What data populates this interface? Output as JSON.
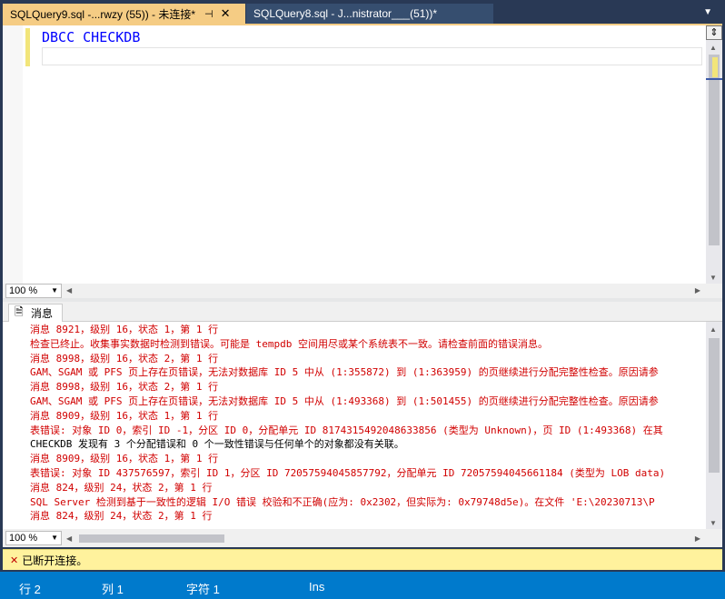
{
  "tabs": [
    {
      "label": "SQLQuery9.sql -...rwzy (55)) - 未连接*",
      "active": true
    },
    {
      "label": "SQLQuery8.sql - J...nistrator___(51))*",
      "active": false
    }
  ],
  "editor": {
    "code_line_1": "DBCC CHECKDB",
    "zoom": "100 %"
  },
  "results": {
    "tab_label": "消息",
    "messages": [
      {
        "text": "消息 8921，级别 16，状态 1，第 1 行",
        "kind": "err"
      },
      {
        "text": "检查已终止。收集事实数据时检测到错误。可能是 tempdb 空间用尽或某个系统表不一致。请检查前面的错误消息。",
        "kind": "err"
      },
      {
        "text": "消息 8998，级别 16，状态 2，第 1 行",
        "kind": "err"
      },
      {
        "text": "GAM、SGAM 或 PFS 页上存在页错误，无法对数据库 ID 5 中从 (1:355872) 到 (1:363959) 的页继续进行分配完整性检查。原因请参",
        "kind": "err"
      },
      {
        "text": "消息 8998，级别 16，状态 2，第 1 行",
        "kind": "err"
      },
      {
        "text": "GAM、SGAM 或 PFS 页上存在页错误，无法对数据库 ID 5 中从 (1:493368) 到 (1:501455) 的页继续进行分配完整性检查。原因请参",
        "kind": "err"
      },
      {
        "text": "消息 8909，级别 16，状态 1，第 1 行",
        "kind": "err"
      },
      {
        "text": "表错误: 对象 ID 0，索引 ID -1，分区 ID 0，分配单元 ID 8174315492048633856 (类型为 Unknown)，页 ID (1:493368) 在其",
        "kind": "err"
      },
      {
        "text": "CHECKDB 发现有 3 个分配错误和 0 个一致性错误与任何单个的对象都没有关联。",
        "kind": "info"
      },
      {
        "text": "消息 8909，级别 16，状态 1，第 1 行",
        "kind": "err"
      },
      {
        "text": "表错误: 对象 ID 437576597，索引 ID 1，分区 ID 72057594045857792，分配单元 ID 72057594045661184 (类型为 LOB data)",
        "kind": "err"
      },
      {
        "text": "消息 824，级别 24，状态 2，第 1 行",
        "kind": "err"
      },
      {
        "text": "SQL Server 检测到基于一致性的逻辑 I/O 错误 校验和不正确(应为: 0x2302，但实际为: 0x79748d5e)。在文件 'E:\\20230713\\P",
        "kind": "err"
      },
      {
        "text": "消息 824，级别 24，状态 2，第 1 行",
        "kind": "err"
      }
    ],
    "zoom": "100 %"
  },
  "connection": {
    "status": "已断开连接。"
  },
  "statusbar": {
    "line": "行 2",
    "col": "列 1",
    "ch": "字符 1",
    "mode": "Ins"
  },
  "colors": {
    "tab_active": "#f5cc84",
    "error_text": "#d10000",
    "keyword": "#0000ff",
    "status_bar": "#007acc",
    "connection_bar": "#fff29d"
  }
}
